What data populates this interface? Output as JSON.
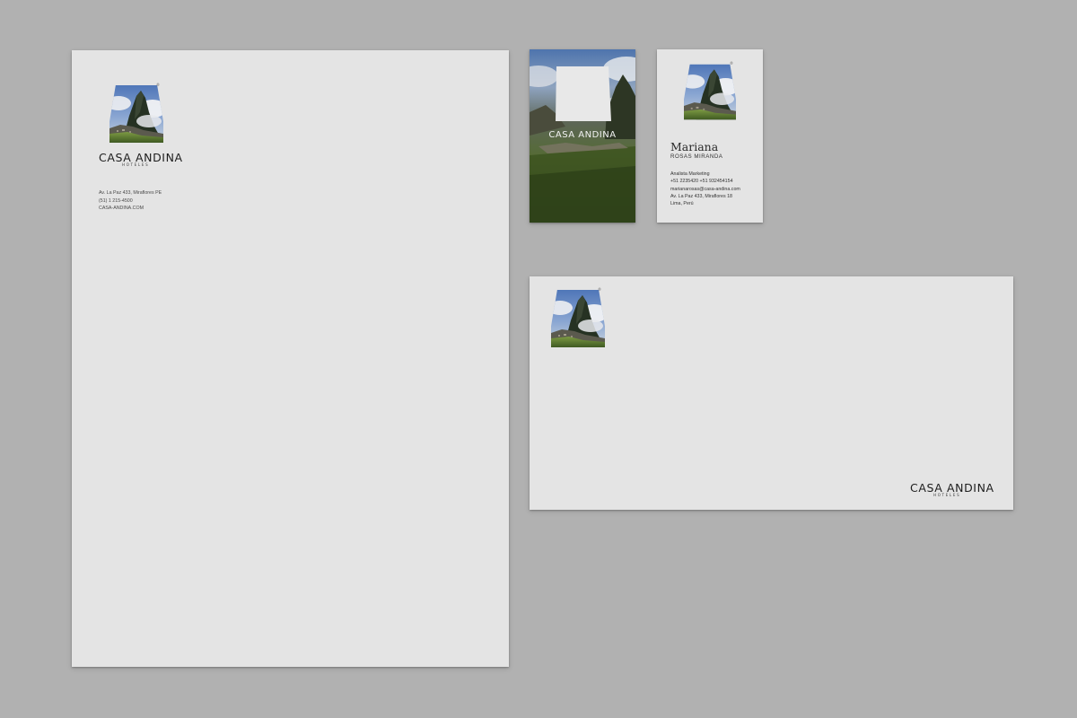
{
  "colors": {
    "background": "#b1b1b1",
    "paper": "#e4e4e4",
    "ink": "#1d1d1d",
    "sky": "#6f93c8",
    "cloud": "#eef0f2",
    "mountain": "#263223",
    "grass": "#6e8f3b"
  },
  "brand": {
    "name": "CASA ANDINA",
    "tagline": "HOTELES",
    "registered": "®"
  },
  "letterhead": {
    "address_lines": [
      "Av. La Paz 433, Miraflores PE",
      "(51) 1 215-4500",
      "CASA-ANDINA.COM"
    ]
  },
  "business_card": {
    "front_brand": "CASA ANDINA",
    "first_name": "Mariana",
    "last_name": "ROSAS MIRANDA",
    "details": [
      "Analista Marketing",
      "+51 2235420  +51 932454154",
      "marianarosas@casa-andina.com",
      "Av. La Paz 433, Miraflores 18",
      "Lima, Perú"
    ]
  },
  "envelope": {
    "brand": "CASA ANDINA",
    "tagline": "HOTELES"
  }
}
